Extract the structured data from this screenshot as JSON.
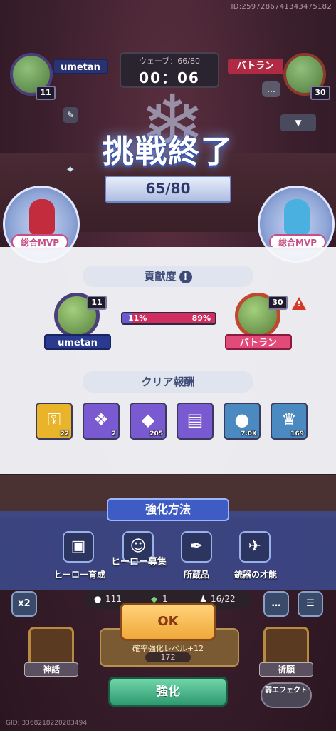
{
  "top_id": "ID:2597286741343475182",
  "header": {
    "player_left": {
      "name": "umetan",
      "level": "11"
    },
    "player_right": {
      "name": "バトラン",
      "level": "30"
    },
    "wave_label": "ウェーブ：66/80",
    "timer": "00：06"
  },
  "result": {
    "title": "挑戦終了",
    "score": "65/80",
    "mvp_left_label": "総合MVP",
    "mvp_right_label": "総合MVP"
  },
  "contribution": {
    "section_label": "貢献度",
    "info_icon": "!",
    "left": {
      "name": "umetan",
      "level": "11",
      "percent_label": "11%",
      "percent": 11
    },
    "right": {
      "name": "バトラン",
      "level": "30",
      "percent_label": "89%",
      "percent": 89
    },
    "warning_icon": "!"
  },
  "rewards": {
    "section_label": "クリア報酬",
    "items": [
      {
        "icon": "gold-key-icon",
        "qty": "22",
        "color": "#e9b42a"
      },
      {
        "icon": "blue-crystal-icon",
        "qty": "2",
        "color": "#7a5ad0"
      },
      {
        "icon": "purple-gem-icon",
        "qty": "205",
        "color": "#7a5ad0"
      },
      {
        "icon": "purple-chest-icon",
        "qty": "",
        "color": "#7a5ad0"
      },
      {
        "icon": "gold-coin-icon",
        "qty": "7.0K",
        "color": "#4a8ac0"
      },
      {
        "icon": "trophy-icon",
        "qty": "169",
        "color": "#4a8ac0"
      }
    ]
  },
  "enhance": {
    "title": "強化方法",
    "options": [
      {
        "label": "ヒーロー育成",
        "icon": "hero-card-icon"
      },
      {
        "label": "ヒーロー募集",
        "icon": "recruit-icon"
      },
      {
        "label": "所蔵品",
        "icon": "feather-icon"
      },
      {
        "label": "銃器の才能",
        "icon": "gun-icon"
      }
    ]
  },
  "hud": {
    "speed": "x2",
    "coins": "111",
    "gems": "1",
    "units": "16/22",
    "ok": "OK",
    "upgrade_cost": "172",
    "upgrade_text": "確率強化レベル+12",
    "myth_label": "神話",
    "prayer_label": "祈願",
    "enhance_label": "強化",
    "fx_label": "弱エフェクト",
    "gid": "GID: 3368218220283494"
  }
}
